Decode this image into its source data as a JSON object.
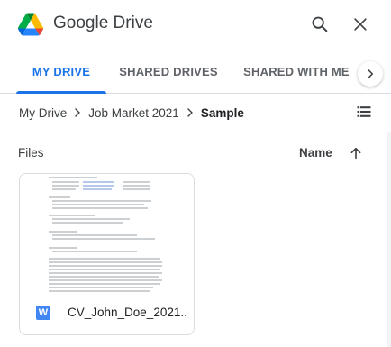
{
  "header": {
    "title": "Google Drive",
    "search_icon": "search-icon",
    "close_icon": "close-icon"
  },
  "tabs": [
    {
      "label": "MY DRIVE",
      "active": true
    },
    {
      "label": "SHARED DRIVES",
      "active": false
    },
    {
      "label": "SHARED WITH ME",
      "active": false
    }
  ],
  "breadcrumb": {
    "items": [
      "My Drive",
      "Job Market 2021",
      "Sample"
    ]
  },
  "files_section": {
    "label": "Files",
    "sort_label": "Name",
    "sort_direction": "ascending"
  },
  "files": [
    {
      "name": "CV_John_Doe_2021....",
      "type_badge": "W",
      "type_icon": "word-doc-icon"
    }
  ],
  "colors": {
    "accent": "#1a73e8",
    "word_blue": "#4285f4",
    "divider": "#dadce0"
  }
}
